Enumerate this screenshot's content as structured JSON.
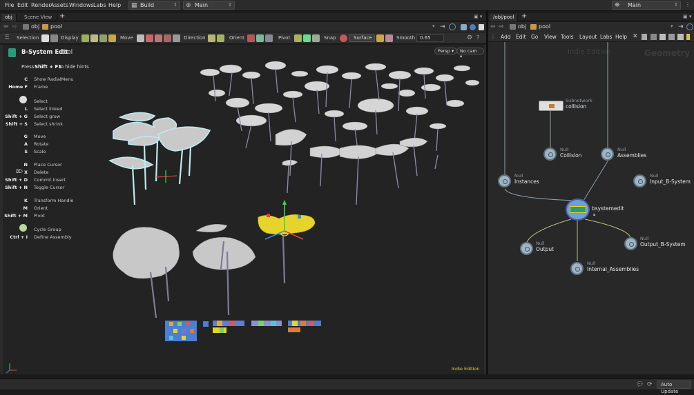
{
  "menubar": {
    "items": [
      "File",
      "Edit",
      "Render",
      "Assets",
      "Windows",
      "Labs",
      "Help"
    ],
    "desktop_build": "Build",
    "desktop_main": "Main",
    "right_main": "Main"
  },
  "left_pane": {
    "tabs": [
      "obj",
      "Scene View"
    ],
    "path_obj": "obj",
    "path_pool": "pool",
    "toolbar": {
      "selection": "Selection",
      "display": "Display",
      "move": "Move",
      "direction": "Direction",
      "orient": "Orient",
      "pivot": "Pivot",
      "snap": "Snap",
      "surface": "Surface",
      "smooth": "Smooth",
      "smooth_value": "0.65"
    }
  },
  "viewport": {
    "tool_title": "B-System Edit",
    "tool_suffix": "tool",
    "hint_prefix": "Press",
    "hint_keys": "Shift + F1",
    "hint_suffix": "to hide hints",
    "persp": "Persp",
    "nocam": "No cam",
    "indie": "Indie Edition",
    "hints": [
      {
        "key": "C",
        "label": "Show RadialMenu"
      },
      {
        "key": "Home  F",
        "label": "Frame"
      },
      {
        "key": "",
        "label": "Select"
      },
      {
        "key": "L",
        "label": "Select linked"
      },
      {
        "key": "Shift + G",
        "label": "Select grow"
      },
      {
        "key": "Shift + S",
        "label": "Select shrink"
      },
      {
        "key": "G",
        "label": "Move"
      },
      {
        "key": "A",
        "label": "Rotate"
      },
      {
        "key": "S",
        "label": "Scale"
      },
      {
        "key": "N",
        "label": "Place Cursor"
      },
      {
        "key": "X",
        "label": "Delete"
      },
      {
        "key": "Shift + D",
        "label": "Commit Insert"
      },
      {
        "key": "Shift + N",
        "label": "Toggle Cursor"
      },
      {
        "key": "K",
        "label": "Transform Handle"
      },
      {
        "key": "M",
        "label": "Orient"
      },
      {
        "key": "Shift + M",
        "label": "Pivot"
      },
      {
        "key": "",
        "label": "Cycle Group"
      },
      {
        "key": "Ctrl + I",
        "label": "Define Assembly"
      }
    ]
  },
  "right_pane": {
    "tab": "/obj/pool",
    "path_obj": "obj",
    "path_pool": "pool",
    "menu": [
      "Add",
      "Edit",
      "Go",
      "View",
      "Tools",
      "Layout",
      "Labs",
      "Help"
    ],
    "watermark_indie": "Indie Edition",
    "watermark_geo": "Geometry",
    "nodes": [
      {
        "type": "Subnetwork",
        "name": "collision"
      },
      {
        "type": "Null",
        "name": "Collision"
      },
      {
        "type": "Null",
        "name": "Assemblies"
      },
      {
        "type": "Null",
        "name": "Instances"
      },
      {
        "type": "Null",
        "name": "Input_B-System"
      },
      {
        "type": "",
        "name": "bsystemedit"
      },
      {
        "type": "Null",
        "name": "Output"
      },
      {
        "type": "Null",
        "name": "Output_B-System"
      },
      {
        "type": "Null",
        "name": "Internal_Assemblies"
      }
    ]
  },
  "status": {
    "auto_update": "Auto Update"
  },
  "colors": {
    "accent_yellow": "#e6d42a",
    "select_outline": "#bfe9ef",
    "node_blue": "#9fb4c4"
  }
}
